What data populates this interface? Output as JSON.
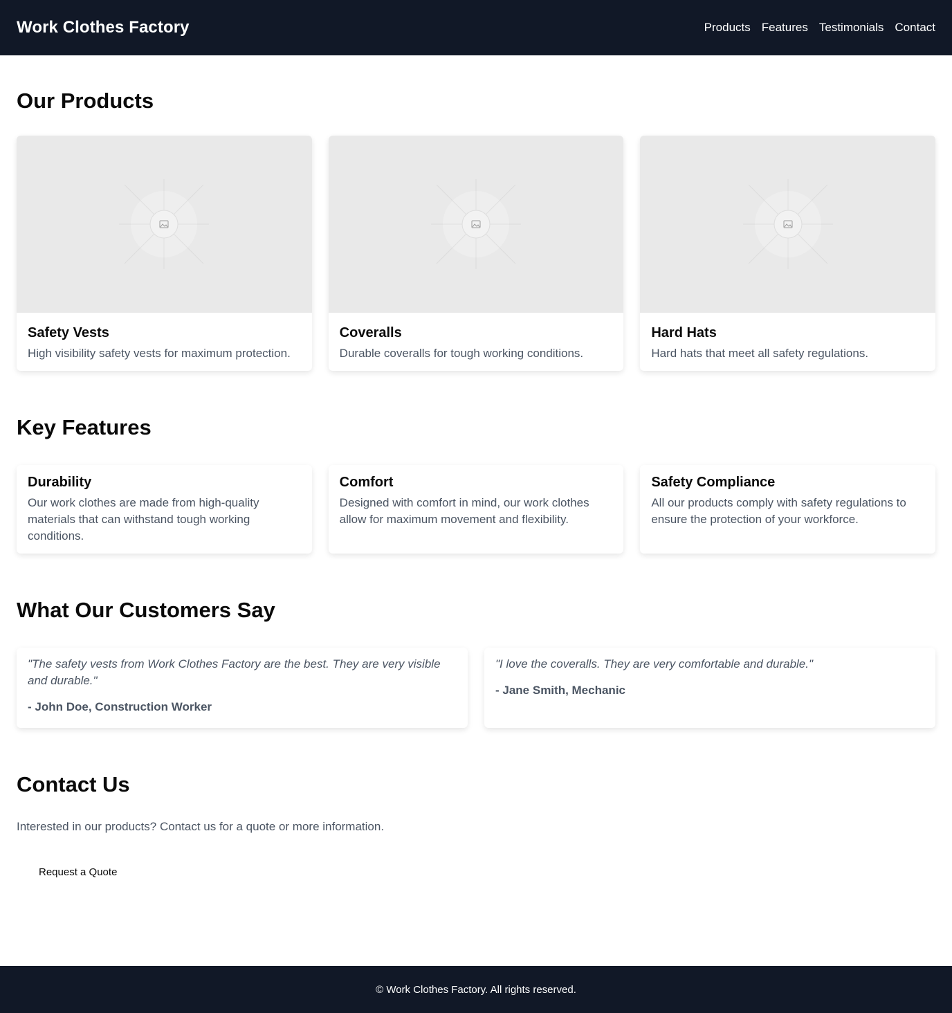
{
  "header": {
    "brand": "Work Clothes Factory",
    "nav": [
      "Products",
      "Features",
      "Testimonials",
      "Contact"
    ]
  },
  "products": {
    "title": "Our Products",
    "items": [
      {
        "name": "Safety Vests",
        "description": "High visibility safety vests for maximum protection.",
        "image_icon": "image-placeholder-icon"
      },
      {
        "name": "Coveralls",
        "description": "Durable coveralls for tough working conditions.",
        "image_icon": "image-placeholder-icon"
      },
      {
        "name": "Hard Hats",
        "description": "Hard hats that meet all safety regulations.",
        "image_icon": "image-placeholder-icon"
      }
    ]
  },
  "features": {
    "title": "Key Features",
    "items": [
      {
        "name": "Durability",
        "description": "Our work clothes are made from high-quality materials that can withstand tough working conditions."
      },
      {
        "name": "Comfort",
        "description": "Designed with comfort in mind, our work clothes allow for maximum movement and flexibility."
      },
      {
        "name": "Safety Compliance",
        "description": "All our products comply with safety regulations to ensure the protection of your workforce."
      }
    ]
  },
  "testimonials": {
    "title": "What Our Customers Say",
    "items": [
      {
        "quote": "\"The safety vests from Work Clothes Factory are the best. They are very visible and durable.\"",
        "author": "- John Doe, Construction Worker"
      },
      {
        "quote": "\"I love the coveralls. They are very comfortable and durable.\"",
        "author": "- Jane Smith, Mechanic"
      }
    ]
  },
  "contact": {
    "title": "Contact Us",
    "text": "Interested in our products? Contact us for a quote or more information.",
    "button": "Request a Quote"
  },
  "footer": {
    "text": "© Work Clothes Factory. All rights reserved."
  },
  "colors": {
    "header_bg": "#111827",
    "image_placeholder_bg": "#e9e9e9",
    "muted_text": "#4b5563"
  }
}
